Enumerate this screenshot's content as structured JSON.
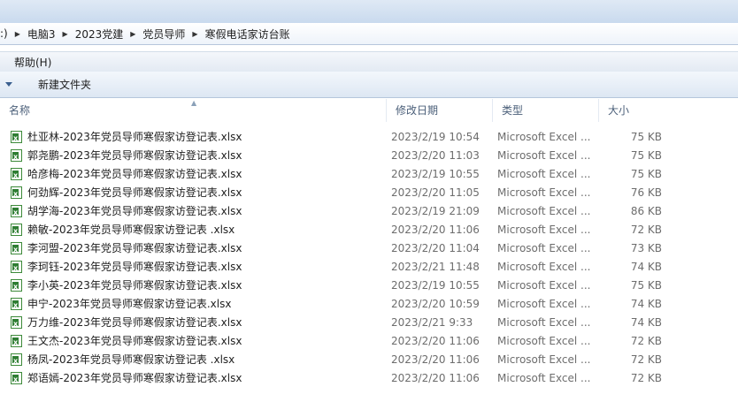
{
  "breadcrumb": {
    "lead": ":)",
    "items": [
      "电脑3",
      "2023党建",
      "党员导师",
      "寒假电话家访台账"
    ]
  },
  "menubar": {
    "help": "帮助(H)"
  },
  "toolbar": {
    "new_folder": "新建文件夹"
  },
  "columns": {
    "name": "名称",
    "date": "修改日期",
    "type": "类型",
    "size": "大小"
  },
  "files": [
    {
      "name": "杜亚林-2023年党员导师寒假家访登记表.xlsx",
      "date": "2023/2/19 10:54",
      "type": "Microsoft Excel ...",
      "size": "75 KB"
    },
    {
      "name": "郭尧鹏-2023年党员导师寒假家访登记表.xlsx",
      "date": "2023/2/20 11:03",
      "type": "Microsoft Excel ...",
      "size": "75 KB"
    },
    {
      "name": "哈彦梅-2023年党员导师寒假家访登记表.xlsx",
      "date": "2023/2/19 10:55",
      "type": "Microsoft Excel ...",
      "size": "75 KB"
    },
    {
      "name": "何劲辉-2023年党员导师寒假家访登记表.xlsx",
      "date": "2023/2/20 11:05",
      "type": "Microsoft Excel ...",
      "size": "76 KB"
    },
    {
      "name": "胡学海-2023年党员导师寒假家访登记表.xlsx",
      "date": "2023/2/19 21:09",
      "type": "Microsoft Excel ...",
      "size": "86 KB"
    },
    {
      "name": "赖敏-2023年党员导师寒假家访登记表 .xlsx",
      "date": "2023/2/20 11:06",
      "type": "Microsoft Excel ...",
      "size": "72 KB"
    },
    {
      "name": "李河盟-2023年党员导师寒假家访登记表.xlsx",
      "date": "2023/2/20 11:04",
      "type": "Microsoft Excel ...",
      "size": "73 KB"
    },
    {
      "name": "李珂钰-2023年党员导师寒假家访登记表.xlsx",
      "date": "2023/2/21 11:48",
      "type": "Microsoft Excel ...",
      "size": "74 KB"
    },
    {
      "name": "李小英-2023年党员导师寒假家访登记表.xlsx",
      "date": "2023/2/19 10:55",
      "type": "Microsoft Excel ...",
      "size": "75 KB"
    },
    {
      "name": "申宁-2023年党员导师寒假家访登记表.xlsx",
      "date": "2023/2/20 10:59",
      "type": "Microsoft Excel ...",
      "size": "74 KB"
    },
    {
      "name": "万力维-2023年党员导师寒假家访登记表.xlsx",
      "date": "2023/2/21 9:33",
      "type": "Microsoft Excel ...",
      "size": "74 KB"
    },
    {
      "name": "王文杰-2023年党员导师寒假家访登记表.xlsx",
      "date": "2023/2/20 11:06",
      "type": "Microsoft Excel ...",
      "size": "72 KB"
    },
    {
      "name": "杨凤-2023年党员导师寒假家访登记表 .xlsx",
      "date": "2023/2/20 11:06",
      "type": "Microsoft Excel ...",
      "size": "72 KB"
    },
    {
      "name": "郑语嫣-2023年党员导师寒假家访登记表.xlsx",
      "date": "2023/2/20 11:06",
      "type": "Microsoft Excel ...",
      "size": "72 KB"
    }
  ]
}
